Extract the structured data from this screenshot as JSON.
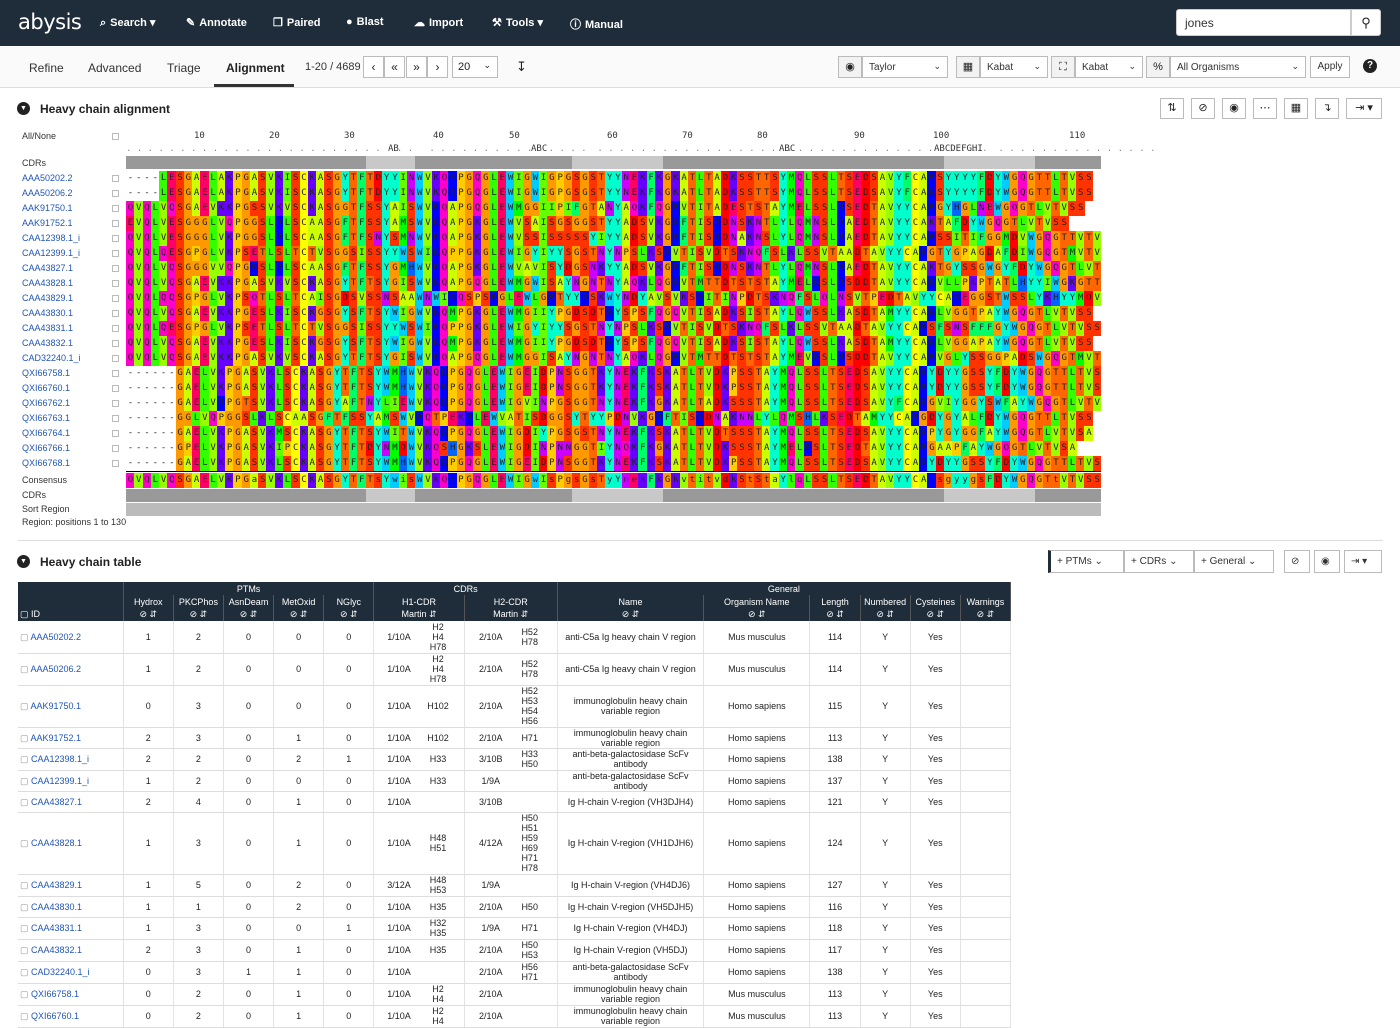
{
  "app": {
    "logo": "abysis"
  },
  "nav": [
    {
      "label": "Search",
      "icon": "search-icon",
      "glyph": "⌕",
      "caret": true
    },
    {
      "label": "Annotate",
      "icon": "pencil-icon",
      "glyph": "✎",
      "caret": false
    },
    {
      "label": "Paired",
      "icon": "copy-icon",
      "glyph": "❐",
      "caret": false
    },
    {
      "label": "Blast",
      "icon": "bomb-icon",
      "glyph": "●",
      "caret": false
    },
    {
      "label": "Import",
      "icon": "cloud-upload-icon",
      "glyph": "☁",
      "caret": false
    },
    {
      "label": "Tools",
      "icon": "wrench-icon",
      "glyph": "⚒",
      "caret": true
    },
    {
      "label": "Manual",
      "icon": "info-icon",
      "glyph": "ⓘ",
      "caret": false
    }
  ],
  "search": {
    "value": "jones"
  },
  "subtabs": [
    "Refine",
    "Advanced",
    "Triage",
    "Alignment"
  ],
  "pager": {
    "range": "1-20 / 4689",
    "page_size": "20"
  },
  "options": {
    "color_scheme": "Taylor",
    "numbering": "Kabat",
    "cdr_definition": "Kabat",
    "organism": "All Organisms",
    "apply": "Apply"
  },
  "alignment": {
    "title": "Heavy chain alignment",
    "all_none": "All/None",
    "cdrs_label": "CDRs",
    "consensus_label": "Consensus",
    "sort_label": "Sort Region",
    "region_label": "Region: positions 1 to 130",
    "ruler_numbers": [
      "10",
      "20",
      "30",
      "40",
      "50",
      "60",
      "70",
      "80",
      "90",
      "100",
      "110"
    ],
    "ruler_inserts": [
      "AB",
      "ABC",
      "ABC",
      "ABCDEFGHI"
    ],
    "rows": [
      {
        "id": "AAA50202.2",
        "seq": "----LESGAELAKPGASVKISCKASGYTFTDYYINWVKQRPGQGLEWIGWIGPGSGSTYYNEKFKGKATLTADKSSTTSYMQLSSLTSEDSAVYFCARSYYYYFDYWGQGTTLTVSS"
      },
      {
        "id": "AAA50206.2",
        "seq": "----LESGAELAKPGASVKISCKASGYTFTDYYINWVKQRPGQGLEWIGWIGPGSGSTYYNEKFKGKATLTADKSSTTSYMQLSSLTSEDSAVYFCARSYYYYFDYWGQGTTLTVSS"
      },
      {
        "id": "AAK91750.1",
        "seq": "QVQLVQSGAEVKKPGSSVKVSCKASGGTFSSYAISWVRQAPGQGLEWMGGIIPIFGTANYAQKFQGRVTITADESTSTAYMELSSLRSEDTAVYYCARGYHGLNEWGQGTLVTVSS"
      },
      {
        "id": "AAK91752.1",
        "seq": "EVQLVESGGGLVQPGGSLRLSCAASGFTFSSYAMSWVRQAPGKGLEWVSAISGSGGSTYYADSVKGRFTISRDNSKNTLYLQMNSLRAEDTAVYYCAKTAFDYWGQGTLVTVSS"
      },
      {
        "id": "CAA12398.1_i",
        "seq": "QVQLVESGGGLVKPGGSLRLSCAASGFTFSNYSMNWVRQAPGKGLEWVSSISSSSSYIYYADSVKGRFTISRDNAKNSLYLQMNSLRAEDTAVYYCARSSITIFGGMDVWGQGTTVTVSS"
      },
      {
        "id": "CAA12399.1_i",
        "seq": "QVQLQESGPGLVKPSETLSLTCTVSGGSISSYYWSWIRQPPGKGLEWIGYIYYSGSTNYNPSLKSRVTISVDTSKNQFSLKLSSVTAADTAVYYCARGTYGPAGDAFDIWGQGTMVTVSS"
      },
      {
        "id": "CAA43827.1",
        "seq": "QVQLVQSGGGVVQPGRSLRLSCAASGFTFSSYGMHWVRQAPGKGLEWVAVISYDGSNKYYADSVKGRFTISRDNSKNTLYLQMNSLRAEDTAVYYCAKTGYSSGWGYFDYWGQGTLVTVSS"
      },
      {
        "id": "CAA43828.1",
        "seq": "QVQLVQSGAEVKKPGASVKVSCKASGYTFTSYGISWVRQAPGQGLEWMGWISAYNGNTNYAQKLQGRVTMTTDTSTSTAYMELRSLRSDDTAVYYCARVLLPKPTATLHYYIWGKGTTVTVSS"
      },
      {
        "id": "CAA43829.1",
        "seq": "QVQLQQSGPGLVKPSQTLSLTCAISGDSVSSNSAAWNWIRQSPSRGLEWLGRTYYRSKWYNDYAVSVKSRITINPDTSKNQFSLQLNSVTPEDTAVYYCAREGGSTWSSLYKHYYMDVWGKGTTVTVSS"
      },
      {
        "id": "CAA43830.1",
        "seq": "QVQLVQSGAEVKKPGESLKISCKGSGYSFTSYWIGWVRQMPGKGLEWMGIIYPGDSDTRYSPSFQGQVTISADKSISTAYLQWSSLKASDTAMYYCARLVGGTPAYWGQGTLVTVSS"
      },
      {
        "id": "CAA43831.1",
        "seq": "QVQLQESGPGLVKPSETLSLTCTVSGGSISSYYWSWIRQPPGKGLEWIGYIYYSGSTNYNPSLKSRVTISVDTSKNQFSLKLSSVTAADTAVYYCARSFSNSFFFGYWGQGTLVTVSS"
      },
      {
        "id": "CAA43832.1",
        "seq": "QVQLVQSGAEVKKPGESLKISCKGSGYSFTSYWIGWVRQMPGKGLEWMGIIYPGDSDTRYSPSFQGQVTISADKSISTAYLQWSSLKASDTAMYYCARLVGGAPAYWGQGTLVTVSS"
      },
      {
        "id": "CAD32240.1_i",
        "seq": "QVQLVQSGAEVKKPGASVKVSCKASGYTFTSYGISWVRQAPGQGLEWMGGISAYNGNTNYAQKLQGRVTMTTDTSTSTAYMEVRSLRSDDTAVYYCARVGLYSSGGPADSWGQGTMVTVSS"
      },
      {
        "id": "QXI66758.1",
        "seq": "------GAELVKPGASVKLSCKASGYTFTSYWMHWVKQRPGQGLEWIGEIDPNSGGTKYNEKFKSKATLTVDKPSSTAYMQLSSLTSEDSAVYYCARYDYYGSSYFDYWGQGTTLTVSS"
      },
      {
        "id": "QXI66760.1",
        "seq": "------GAELVKPGASVKLSCKASGYTFTSYWMHWVKQRPGQGLEWIGEIDPNSGGTKYNEKFKSKATLTVDKPSSTAYMQLSSLTSEDSAVYYCARYDYYGSSYFDYWGQGTTLTVSS"
      },
      {
        "id": "QXI66762.1",
        "seq": "------GAELVRPGTSVKLSCKASGYAFTNYLIEWVKQRPGQGLEWIGVINPGSGGTNYNEKFKGKATLTADKSSSTAYMQLSSLTSEDSAVYFCARGVIYGGYSWFAYWGQGTLVTVSA"
      },
      {
        "id": "QXI66763.1",
        "seq": "------GGLVQPGGSLKLSCAASGFTFSSYAMSWVRQTPEKRLEWVATISDGGSYTYYPDNVKGRFTISRDNAKNNLYLQMSHLKSEDTAMYYCARGDYGYALFDYWGQGTTLTVSS"
      },
      {
        "id": "QXI66764.1",
        "seq": "------GAELVKPGASVKMSCKASGYTFTSYWITWVKQRPGQGLEWIGDIYPGSGSTNYNEKFKSKATLTVDTSSSTAYMQLSSLTSEDSAVYYCARPYGYGGFAYWGQGTLVTVSA"
      },
      {
        "id": "QXI66766.1",
        "seq": "------GPELVKPGASVKIPCKASGYTFTDYNMDWVKQSHGKSLEWIGDINPNNGGTIYNQKFKGKATLTVDKSSSTAYMELRSLTSEDTAVYYCARGAAPFAYWGQGTLVTVSA"
      },
      {
        "id": "QXI66768.1",
        "seq": "------GAELVKPGASVKLSCKASGYTFTSYWMHWVKQRPGQGLEWIGEIDPNSGGTKYNEKFKSKATLTVDKPSSTAYMQLSSLTSEDSAVYYCARYDYYGSSYFDYWGQGTTLTVSS"
      }
    ],
    "consensus": "QVQLVQSGAELVKPGaSVKLSCKASGYTFTsYwisWVkQrPGQGLEWIGwIsPgsGsTyYnekFkGkvtitvdkStStaYlqLSSLTSEDTAVYYCArsgyygsFDYWGQGTtVTVSS"
  },
  "table": {
    "title": "Heavy chain table",
    "filters": [
      "+ PTMs",
      "+ CDRs",
      "+ General"
    ],
    "groups": [
      "PTMs",
      "CDRs",
      "General"
    ],
    "columns": [
      "ID",
      "Hydrox",
      "PKCPhos",
      "AsnDeam",
      "MetOxid",
      "NGlyc",
      "H1-CDR",
      "H2-CDR",
      "Name",
      "Organism Name",
      "Length",
      "Numbered",
      "Cysteines",
      "Warnings"
    ],
    "subcolumns": {
      "h1": "Martin",
      "h2": "Martin"
    },
    "rows": [
      {
        "id": "AAA50202.2",
        "hydrox": "1",
        "pkc": "2",
        "asn": "0",
        "met": "0",
        "ngly": "0",
        "h1len": "1/10A",
        "h1pos": "H2 H4 H78",
        "h2len": "2/10A",
        "h2pos": "H52 H78",
        "name": "anti-C5a Ig heavy chain V region",
        "org": "Mus musculus",
        "len": "114",
        "num": "Y",
        "cys": "Yes"
      },
      {
        "id": "AAA50206.2",
        "hydrox": "1",
        "pkc": "2",
        "asn": "0",
        "met": "0",
        "ngly": "0",
        "h1len": "1/10A",
        "h1pos": "H2 H4 H78",
        "h2len": "2/10A",
        "h2pos": "H52 H78",
        "name": "anti-C5a Ig heavy chain V region",
        "org": "Mus musculus",
        "len": "114",
        "num": "Y",
        "cys": "Yes"
      },
      {
        "id": "AAK91750.1",
        "hydrox": "0",
        "pkc": "3",
        "asn": "0",
        "met": "0",
        "ngly": "0",
        "h1len": "1/10A",
        "h1pos": "H102",
        "h2len": "2/10A",
        "h2pos": "H52 H53 H54 H56",
        "name": "immunoglobulin heavy chain variable region",
        "org": "Homo sapiens",
        "len": "115",
        "num": "Y",
        "cys": "Yes"
      },
      {
        "id": "AAK91752.1",
        "hydrox": "2",
        "pkc": "3",
        "asn": "0",
        "met": "1",
        "ngly": "0",
        "h1len": "1/10A",
        "h1pos": "H102",
        "h2len": "2/10A",
        "h2pos": "H71",
        "name": "immunoglobulin heavy chain variable region",
        "org": "Homo sapiens",
        "len": "113",
        "num": "Y",
        "cys": "Yes"
      },
      {
        "id": "CAA12398.1_i",
        "hydrox": "2",
        "pkc": "2",
        "asn": "0",
        "met": "2",
        "ngly": "1",
        "h1len": "1/10A",
        "h1pos": "H33",
        "h2len": "3/10B",
        "h2pos": "H33 H50",
        "name": "anti-beta-galactosidase ScFv antibody",
        "org": "Homo sapiens",
        "len": "138",
        "num": "Y",
        "cys": "Yes"
      },
      {
        "id": "CAA12399.1_i",
        "hydrox": "1",
        "pkc": "2",
        "asn": "0",
        "met": "0",
        "ngly": "0",
        "h1len": "1/10A",
        "h1pos": "H33",
        "h2len": "1/9A",
        "h2pos": "",
        "name": "anti-beta-galactosidase ScFv antibody",
        "org": "Homo sapiens",
        "len": "137",
        "num": "Y",
        "cys": "Yes"
      },
      {
        "id": "CAA43827.1",
        "hydrox": "2",
        "pkc": "4",
        "asn": "0",
        "met": "1",
        "ngly": "0",
        "h1len": "1/10A",
        "h1pos": "",
        "h2len": "3/10B",
        "h2pos": "",
        "name": "Ig H-chain V-region (VH3DJH4)",
        "org": "Homo sapiens",
        "len": "121",
        "num": "Y",
        "cys": "Yes"
      },
      {
        "id": "CAA43828.1",
        "hydrox": "1",
        "pkc": "3",
        "asn": "0",
        "met": "1",
        "ngly": "0",
        "h1len": "1/10A",
        "h1pos": "H48 H51",
        "h2len": "4/12A",
        "h2pos": "H50 H51 H59 H69 H71 H78",
        "name": "Ig H-chain V-region (VH1DJH6)",
        "org": "Homo sapiens",
        "len": "124",
        "num": "Y",
        "cys": "Yes"
      },
      {
        "id": "CAA43829.1",
        "hydrox": "1",
        "pkc": "5",
        "asn": "0",
        "met": "2",
        "ngly": "0",
        "h1len": "3/12A",
        "h1pos": "H48 H53",
        "h2len": "1/9A",
        "h2pos": "",
        "name": "Ig H-chain V-region (VH4DJ6)",
        "org": "Homo sapiens",
        "len": "127",
        "num": "Y",
        "cys": "Yes"
      },
      {
        "id": "CAA43830.1",
        "hydrox": "1",
        "pkc": "1",
        "asn": "0",
        "met": "2",
        "ngly": "0",
        "h1len": "1/10A",
        "h1pos": "H35",
        "h2len": "2/10A",
        "h2pos": "H50",
        "name": "Ig H-chain V-region (VH5DJH5)",
        "org": "Homo sapiens",
        "len": "116",
        "num": "Y",
        "cys": "Yes"
      },
      {
        "id": "CAA43831.1",
        "hydrox": "1",
        "pkc": "3",
        "asn": "0",
        "met": "0",
        "ngly": "1",
        "h1len": "1/10A",
        "h1pos": "H32 H35",
        "h2len": "1/9A",
        "h2pos": "H71",
        "name": "Ig H-chain V-region (VH4DJ)",
        "org": "Homo sapiens",
        "len": "118",
        "num": "Y",
        "cys": "Yes"
      },
      {
        "id": "CAA43832.1",
        "hydrox": "2",
        "pkc": "3",
        "asn": "0",
        "met": "1",
        "ngly": "0",
        "h1len": "1/10A",
        "h1pos": "H35",
        "h2len": "2/10A",
        "h2pos": "H50 H53",
        "name": "Ig H-chain V-region (VH5DJ)",
        "org": "Homo sapiens",
        "len": "117",
        "num": "Y",
        "cys": "Yes"
      },
      {
        "id": "CAD32240.1_i",
        "hydrox": "0",
        "pkc": "3",
        "asn": "1",
        "met": "1",
        "ngly": "0",
        "h1len": "1/10A",
        "h1pos": "",
        "h2len": "2/10A",
        "h2pos": "H56 H71",
        "name": "anti-beta-galactosidase ScFv antibody",
        "org": "Homo sapiens",
        "len": "138",
        "num": "Y",
        "cys": "Yes"
      },
      {
        "id": "QXI66758.1",
        "hydrox": "0",
        "pkc": "2",
        "asn": "0",
        "met": "1",
        "ngly": "0",
        "h1len": "1/10A",
        "h1pos": "H2 H4",
        "h2len": "2/10A",
        "h2pos": "",
        "name": "immunoglobulin heavy chain variable region",
        "org": "Mus musculus",
        "len": "113",
        "num": "Y",
        "cys": "Yes"
      },
      {
        "id": "QXI66760.1",
        "hydrox": "0",
        "pkc": "2",
        "asn": "0",
        "met": "1",
        "ngly": "0",
        "h1len": "1/10A",
        "h1pos": "H2 H4",
        "h2len": "2/10A",
        "h2pos": "",
        "name": "immunoglobulin heavy chain variable region",
        "org": "Mus musculus",
        "len": "113",
        "num": "Y",
        "cys": "Yes"
      }
    ]
  },
  "colors": {
    "topbar": "#1f2d3a",
    "link": "#2055b8",
    "residue": {
      "A": "#ccff00",
      "V": "#99ff00",
      "I": "#66ff00",
      "L": "#33ff00",
      "M": "#00ff00",
      "F": "#00ff66",
      "Y": "#00ffcc",
      "W": "#00ccff",
      "H": "#0066ff",
      "R": "#0000ff",
      "K": "#6600ff",
      "N": "#cc00ff",
      "Q": "#ff00cc",
      "E": "#ff0066",
      "D": "#ff0000",
      "S": "#ff3300",
      "T": "#ff6600",
      "G": "#ff9900",
      "P": "#ffcc00",
      "C": "#ffff00"
    }
  }
}
